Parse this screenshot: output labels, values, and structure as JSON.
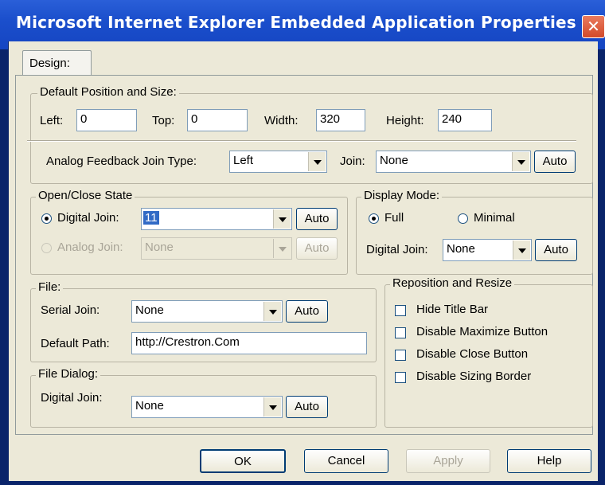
{
  "window": {
    "title": "Microsoft Internet Explorer Embedded Application Properties",
    "close_symbol": "✕"
  },
  "tabs": [
    {
      "label": "Design:"
    }
  ],
  "position_group": {
    "legend": "Default Position and Size:",
    "left_label": "Left:",
    "left_value": "0",
    "top_label": "Top:",
    "top_value": "0",
    "width_label": "Width:",
    "width_value": "320",
    "height_label": "Height:",
    "height_value": "240",
    "analog_label": "Analog Feedback Join Type:",
    "analog_value": "Left",
    "join_label": "Join:",
    "join_value": "None",
    "auto_label": "Auto"
  },
  "open_close": {
    "legend": "Open/Close State",
    "digital_label": "Digital Join:",
    "digital_value": "11",
    "digital_auto": "Auto",
    "analog_label": "Analog Join:",
    "analog_value": "None",
    "analog_auto": "Auto"
  },
  "display_mode": {
    "legend": "Display Mode:",
    "full_label": "Full",
    "minimal_label": "Minimal",
    "digital_label": "Digital Join:",
    "digital_value": "None",
    "auto_label": "Auto"
  },
  "file_group": {
    "legend": "File:",
    "serial_label": "Serial Join:",
    "serial_value": "None",
    "auto_label": "Auto",
    "path_label": "Default Path:",
    "path_value": "http://Crestron.Com"
  },
  "file_dialog": {
    "legend": "File Dialog:",
    "digital_label": "Digital Join:",
    "digital_value": "None",
    "auto_label": "Auto"
  },
  "reposition": {
    "legend": "Reposition and Resize",
    "options": [
      {
        "label": "Hide Title Bar",
        "checked": false
      },
      {
        "label": "Disable Maximize Button",
        "checked": false
      },
      {
        "label": "Disable Close Button",
        "checked": false
      },
      {
        "label": "Disable Sizing Border",
        "checked": false
      }
    ]
  },
  "footer": {
    "ok": "OK",
    "cancel": "Cancel",
    "apply": "Apply",
    "help": "Help"
  }
}
